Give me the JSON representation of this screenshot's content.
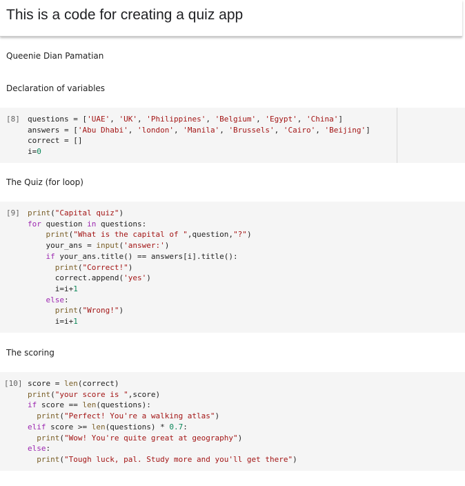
{
  "header": {
    "title": "This is a code for creating a quiz app"
  },
  "author": "Queenie Dian Pamatian",
  "sections": {
    "declaration": "Declaration of variables",
    "quiz": "The Quiz (for loop)",
    "scoring": "The scoring"
  },
  "cells": [
    {
      "prompt": "[8]",
      "lines": [
        "questions = ['UAE', 'UK', 'Philippines', 'Belgium', 'Egypt', 'China']",
        "answers = ['Abu Dhabi', 'london', 'Manila', 'Brussels', 'Cairo', 'Beijing']",
        "correct = []",
        "i=0"
      ]
    },
    {
      "prompt": "[9]",
      "lines": [
        "print(\"Capital quiz\")",
        "for question in questions:",
        "    print(\"What is the capital of \",question,\"?\")",
        "    your_ans = input('answer:')",
        "    if your_ans.title() == answers[i].title():",
        "      print(\"Correct!\")",
        "      correct.append('yes')",
        "      i=i+1",
        "    else:",
        "      print(\"Wrong!\")",
        "      i=i+1"
      ]
    },
    {
      "prompt": "[10]",
      "lines": [
        "score = len(correct)",
        "print(\"your score is \",score)",
        "if score == len(questions):",
        "  print(\"Perfect! You're a walking atlas\")",
        "elif score >= len(questions) * 0.7:",
        "  print(\"Wow! You're quite great at geography\")",
        "else:",
        "  print(\"Tough luck, pal. Study more and you'll get there\")"
      ]
    }
  ]
}
